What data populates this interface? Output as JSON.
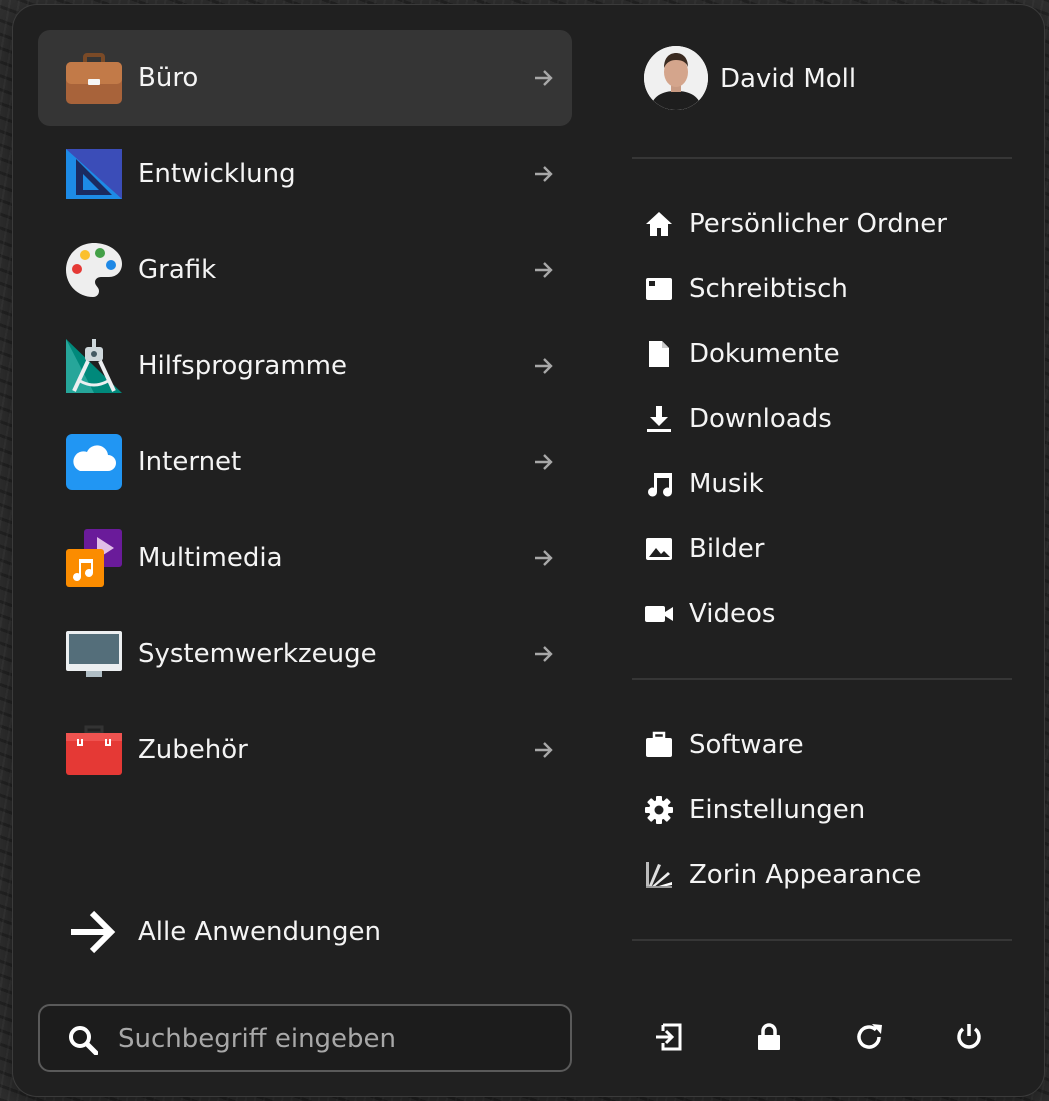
{
  "categories": [
    {
      "label": "Büro",
      "icon": "briefcase-icon"
    },
    {
      "label": "Entwicklung",
      "icon": "development-icon"
    },
    {
      "label": "Grafik",
      "icon": "palette-icon"
    },
    {
      "label": "Hilfsprogramme",
      "icon": "utilities-icon"
    },
    {
      "label": "Internet",
      "icon": "cloud-icon"
    },
    {
      "label": "Multimedia",
      "icon": "multimedia-icon"
    },
    {
      "label": "Systemwerkzeuge",
      "icon": "monitor-icon"
    },
    {
      "label": "Zubehör",
      "icon": "toolbox-icon"
    }
  ],
  "all_apps": {
    "label": "Alle Anwendungen"
  },
  "search": {
    "placeholder": "Suchbegriff eingeben"
  },
  "user": {
    "name": "David Moll"
  },
  "places": [
    {
      "label": "Persönlicher Ordner",
      "icon": "home-icon"
    },
    {
      "label": "Schreibtisch",
      "icon": "desktop-icon"
    },
    {
      "label": "Dokumente",
      "icon": "document-icon"
    },
    {
      "label": "Downloads",
      "icon": "download-icon"
    },
    {
      "label": "Musik",
      "icon": "music-icon"
    },
    {
      "label": "Bilder",
      "icon": "image-icon"
    },
    {
      "label": "Videos",
      "icon": "video-icon"
    }
  ],
  "system": [
    {
      "label": "Software",
      "icon": "software-icon"
    },
    {
      "label": "Einstellungen",
      "icon": "gear-icon"
    },
    {
      "label": "Zorin Appearance",
      "icon": "zorin-appearance-icon"
    }
  ],
  "power": [
    {
      "name": "logout",
      "icon": "logout-icon"
    },
    {
      "name": "lock",
      "icon": "lock-icon"
    },
    {
      "name": "restart",
      "icon": "restart-icon"
    },
    {
      "name": "shutdown",
      "icon": "power-icon"
    }
  ],
  "colors": {
    "panel": "#202020",
    "active_row": "#353535",
    "text": "#f4f4f4"
  }
}
